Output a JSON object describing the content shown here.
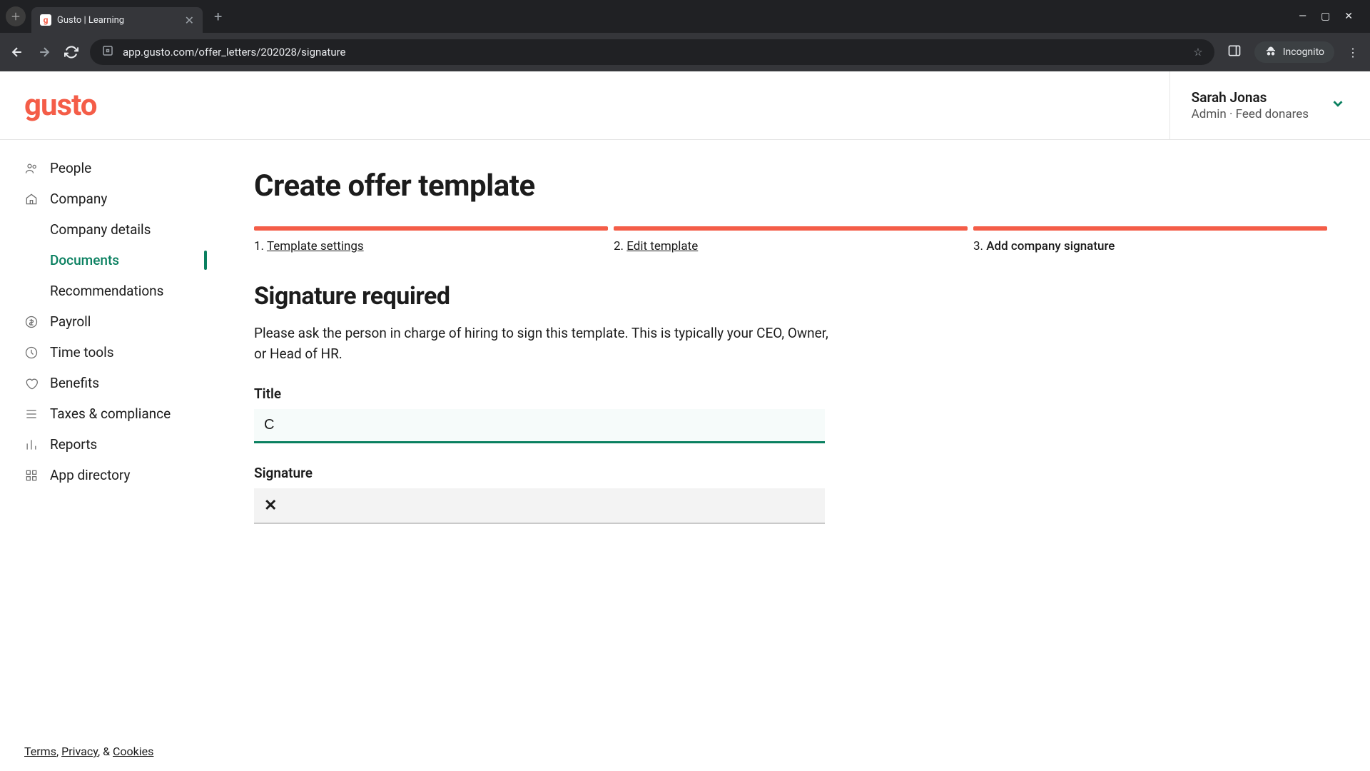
{
  "browser": {
    "tab_title": "Gusto | Learning",
    "url": "app.gusto.com/offer_letters/202028/signature",
    "incognito_label": "Incognito"
  },
  "header": {
    "logo": "gusto",
    "user_name": "Sarah Jonas",
    "user_meta": "Admin · Feed donares"
  },
  "sidebar": {
    "items": [
      {
        "label": "People",
        "icon": "people"
      },
      {
        "label": "Company",
        "icon": "company"
      },
      {
        "label": "Company details",
        "sub": true
      },
      {
        "label": "Documents",
        "sub": true,
        "active": true
      },
      {
        "label": "Recommendations",
        "sub": true
      },
      {
        "label": "Payroll",
        "icon": "payroll"
      },
      {
        "label": "Time tools",
        "icon": "time"
      },
      {
        "label": "Benefits",
        "icon": "benefits"
      },
      {
        "label": "Taxes & compliance",
        "icon": "taxes"
      },
      {
        "label": "Reports",
        "icon": "reports"
      },
      {
        "label": "App directory",
        "icon": "apps"
      }
    ],
    "footer": {
      "terms": "Terms",
      "privacy": "Privacy",
      "cookies": "Cookies",
      "sep1": ", ",
      "sep2": ", & "
    }
  },
  "main": {
    "title": "Create offer template",
    "steps": [
      {
        "num": "1.",
        "label": "Template settings"
      },
      {
        "num": "2.",
        "label": "Edit template"
      },
      {
        "num": "3.",
        "label": "Add company signature"
      }
    ],
    "heading": "Signature required",
    "description": "Please ask the person in charge of hiring to sign this template. This is typically your CEO, Owner, or Head of HR.",
    "title_field_label": "Title",
    "title_field_value": "C",
    "signature_label": "Signature"
  }
}
